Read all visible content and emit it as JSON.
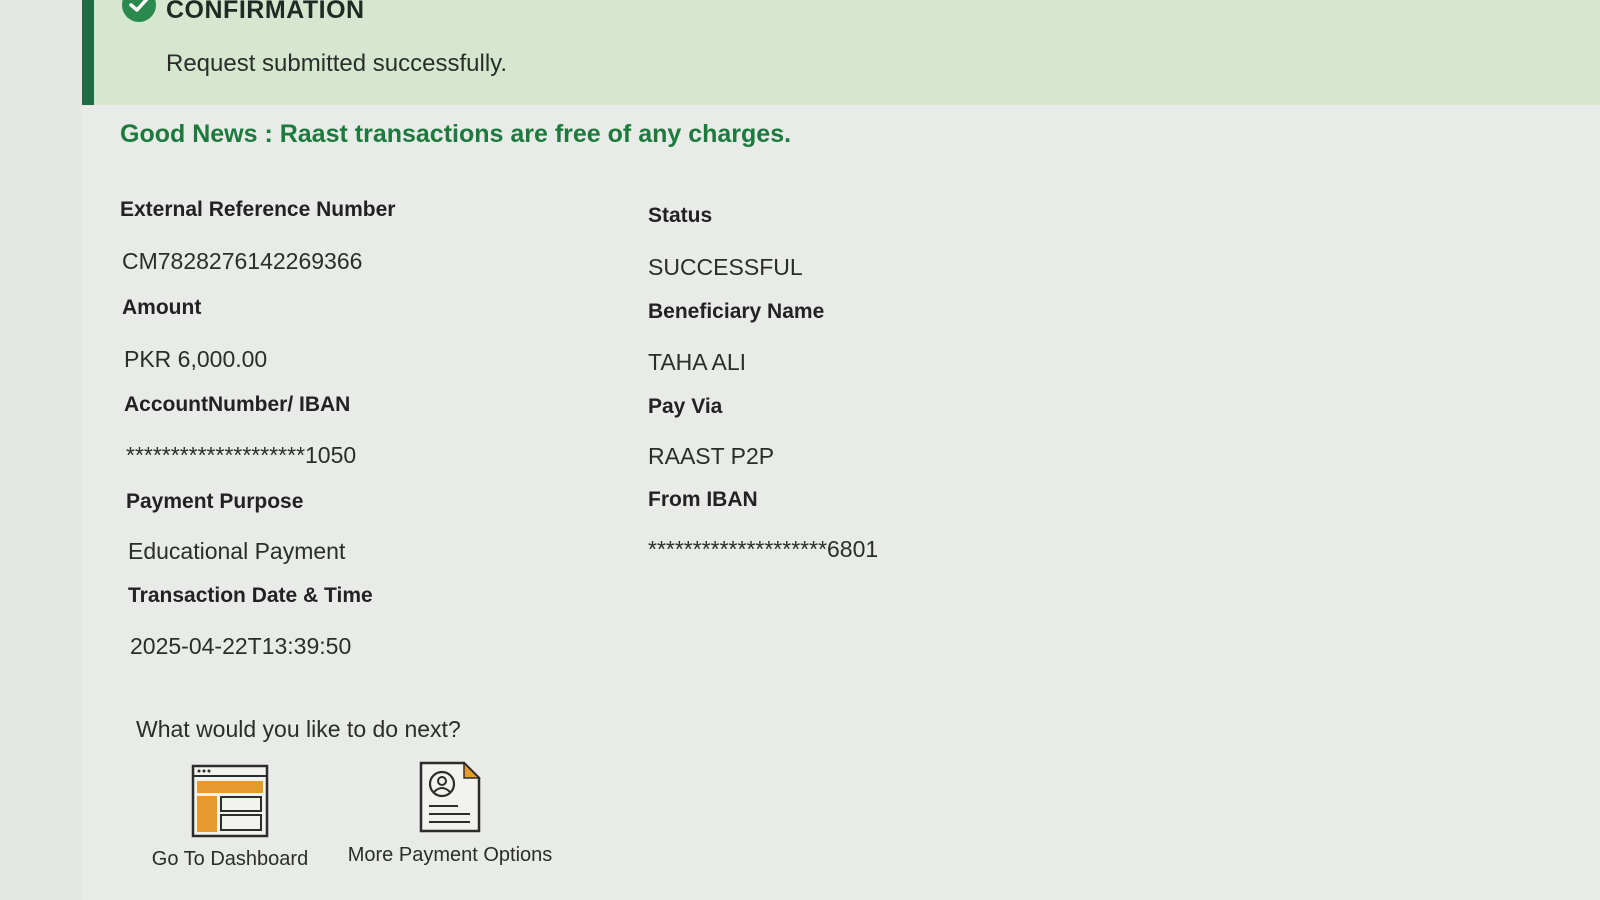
{
  "confirmation": {
    "title": "CONFIRMATION",
    "message": "Request submitted successfully.",
    "icon": "check-circle-icon",
    "accent_color": "#1f6b45"
  },
  "notice": {
    "text": "Good News : Raast transactions are free of any charges.",
    "color": "#1b7a3c"
  },
  "details": {
    "ext_ref_label": "External Reference Number",
    "ext_ref_value": "CM7828276142269366",
    "status_label": "Status",
    "status_value": "SUCCESSFUL",
    "amount_label": "Amount",
    "amount_value": "PKR 6,000.00",
    "beneficiary_label": "Beneficiary Name",
    "beneficiary_value": "TAHA ALI",
    "account_label": "AccountNumber/ IBAN",
    "account_value": "********************1050",
    "payvia_label": "Pay Via",
    "payvia_value": "RAAST P2P",
    "purpose_label": "Payment Purpose",
    "purpose_value": "Educational Payment",
    "from_iban_label": "From IBAN",
    "from_iban_value": "********************6801",
    "datetime_label": "Transaction Date & Time",
    "datetime_value": "2025-04-22T13:39:50"
  },
  "next": {
    "heading": "What would you like to do next?",
    "actions": [
      {
        "label": "Go To Dashboard",
        "icon": "dashboard-icon"
      },
      {
        "label": "More Payment Options",
        "icon": "payment-document-icon"
      }
    ]
  }
}
